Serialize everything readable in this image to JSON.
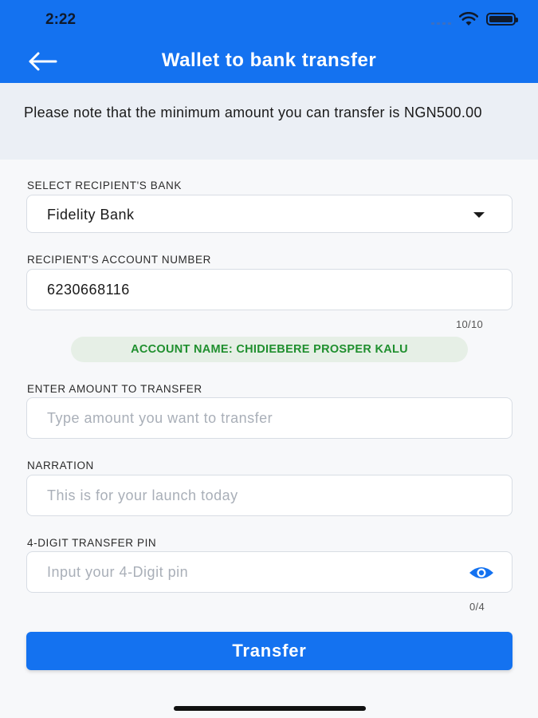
{
  "status_bar": {
    "time": "2:22"
  },
  "header": {
    "title": "Wallet to bank transfer"
  },
  "notice": {
    "text": "Please note that the minimum amount you can transfer is NGN500.00"
  },
  "form": {
    "bank": {
      "label": "SELECT RECIPIENT'S BANK",
      "value": "Fidelity Bank"
    },
    "account_number": {
      "label": "RECIPIENT'S ACCOUNT NUMBER",
      "value": "6230668116",
      "counter": "10/10"
    },
    "account_name": "ACCOUNT NAME: CHIDIEBERE PROSPER KALU",
    "amount": {
      "label": "ENTER AMOUNT TO TRANSFER",
      "placeholder": "Type amount you want to transfer"
    },
    "narration": {
      "label": "NARRATION",
      "placeholder": "This is for your launch today"
    },
    "pin": {
      "label": "4-DIGIT TRANSFER PIN",
      "placeholder": "Input your 4-Digit pin",
      "counter": "0/4"
    }
  },
  "actions": {
    "transfer_label": "Transfer"
  },
  "colors": {
    "primary": "#1472f0",
    "success_text": "#1f8f2e",
    "success_bg": "#e6efe6"
  },
  "icons": [
    "back-arrow-icon",
    "wifi-icon",
    "battery-icon",
    "signal-icon",
    "dropdown-arrow-icon",
    "eye-icon"
  ]
}
